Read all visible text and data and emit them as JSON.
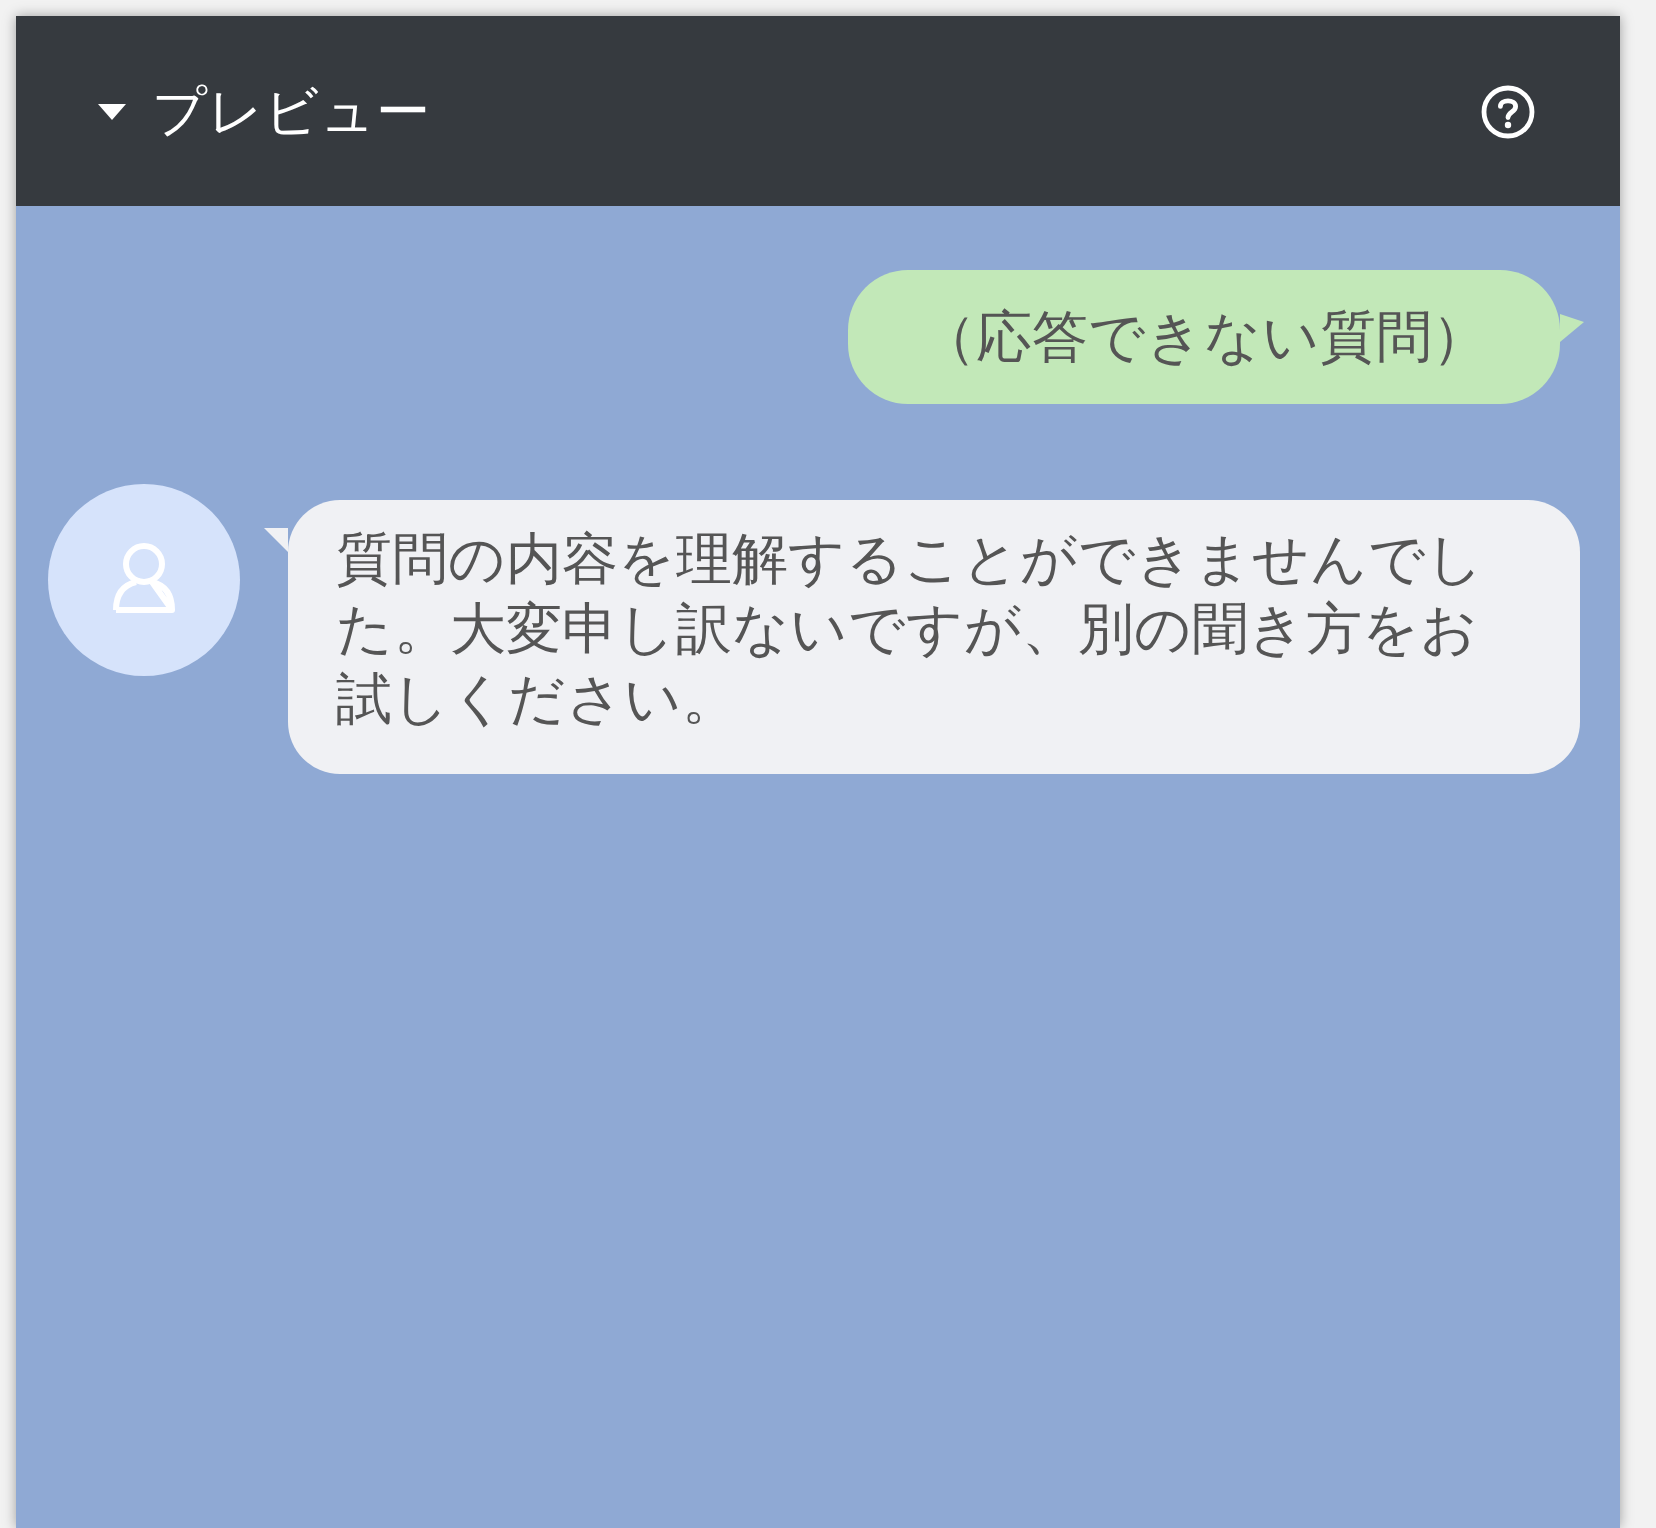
{
  "panel": {
    "title": "プレビュー",
    "expanded": true
  },
  "messages": [
    {
      "kind": "user",
      "text": "（応答できない質問）"
    },
    {
      "kind": "bot",
      "text": "質問の内容を理解することができませんでした。大変申し訳ないですが、別の聞き方をお試しください。"
    }
  ]
}
